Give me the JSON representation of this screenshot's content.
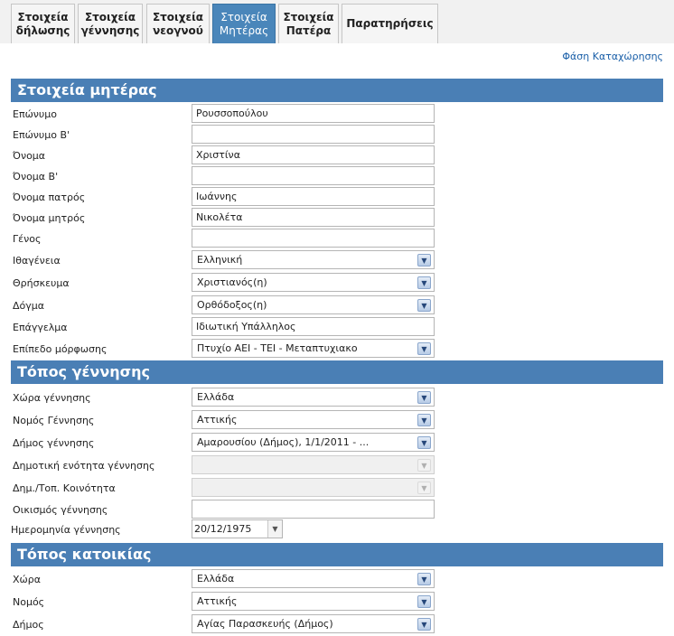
{
  "tabs": [
    {
      "label": "Στοιχεία\nδήλωσης",
      "active": false
    },
    {
      "label": "Στοιχεία\nγέννησης",
      "active": false
    },
    {
      "label": "Στοιχεία\nνεογνού",
      "active": false
    },
    {
      "label": "Στοιχεία\nΜητέρας",
      "active": true
    },
    {
      "label": "Στοιχεία\nΠατέρα",
      "active": false
    },
    {
      "label": "Παρατηρήσεις",
      "active": false
    }
  ],
  "phase_link": "Φάση Καταχώρησης",
  "mother": {
    "title": "Στοιχεία μητέρας",
    "surname_label": "Επώνυμο",
    "surname": "Ρουσσοπούλου",
    "surname_b_label": "Επώνυμο Β'",
    "surname_b": "",
    "name_label": "Όνομα",
    "name": "Χριστίνα",
    "name_b_label": "Όνομα Β'",
    "name_b": "",
    "father_name_label": "Όνομα πατρός",
    "father_name": "Ιωάννης",
    "mother_name_label": "Όνομα μητρός",
    "mother_name": "Νικολέτα",
    "genos_label": "Γένος",
    "genos": "",
    "nationality_label": "Ιθαγένεια",
    "nationality": "Ελληνική",
    "religion_label": "Θρήσκευμα",
    "religion": "Χριστιανός(η)",
    "dogma_label": "Δόγμα",
    "dogma": "Ορθόδοξος(η)",
    "profession_label": "Επάγγελμα",
    "profession": "Ιδιωτική Υπάλληλος",
    "education_label": "Επίπεδο μόρφωσης",
    "education": "Πτυχίο ΑΕΙ - ΤΕΙ - Μεταπτυχιακο"
  },
  "birth_place": {
    "title": "Τόπος γέννησης",
    "country_label": "Χώρα γέννησης",
    "country": "Ελλάδα",
    "prefecture_label": "Νομός Γέννησης",
    "prefecture": "Αττικής",
    "municipality_label": "Δήμος γέννησης",
    "municipality": "Αμαρουσίου (Δήμος), 1/1/2011 - ...",
    "municipal_unit_label": "Δημοτική ενότητα γέννησης",
    "municipal_unit": "",
    "community_label": "Δημ./Τοπ. Κοινότητα",
    "community": "",
    "settlement_label": "Οικισμός γέννησης",
    "settlement": "",
    "birth_date_label": "Ημερομηνία γέννησης",
    "birth_date": "20/12/1975"
  },
  "residence": {
    "title": "Τόπος κατοικίας",
    "country_label": "Χώρα",
    "country": "Ελλάδα",
    "prefecture_label": "Νομός",
    "prefecture": "Αττικής",
    "municipality_label": "Δήμος",
    "municipality": "Αγίας Παρασκευής (Δήμος)"
  },
  "colors": {
    "header": "#4a7fb5",
    "active_tab": "#4a86ba",
    "link": "#1a5fa8"
  }
}
